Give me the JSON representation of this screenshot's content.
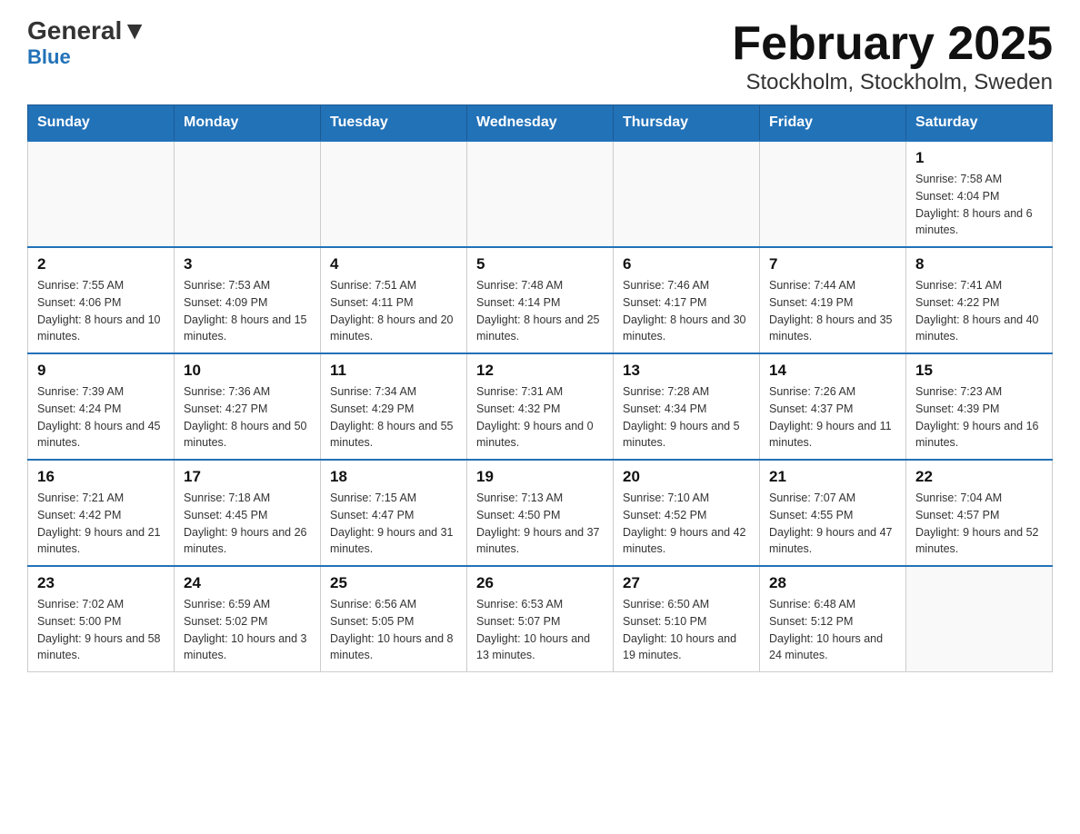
{
  "logo": {
    "line1_part1": "General",
    "line1_part2": "Blue",
    "line2": "Blue"
  },
  "title": "February 2025",
  "subtitle": "Stockholm, Stockholm, Sweden",
  "days_of_week": [
    "Sunday",
    "Monday",
    "Tuesday",
    "Wednesday",
    "Thursday",
    "Friday",
    "Saturday"
  ],
  "weeks": [
    [
      {
        "day": "",
        "sunrise": "",
        "sunset": "",
        "daylight": "",
        "empty": true
      },
      {
        "day": "",
        "sunrise": "",
        "sunset": "",
        "daylight": "",
        "empty": true
      },
      {
        "day": "",
        "sunrise": "",
        "sunset": "",
        "daylight": "",
        "empty": true
      },
      {
        "day": "",
        "sunrise": "",
        "sunset": "",
        "daylight": "",
        "empty": true
      },
      {
        "day": "",
        "sunrise": "",
        "sunset": "",
        "daylight": "",
        "empty": true
      },
      {
        "day": "",
        "sunrise": "",
        "sunset": "",
        "daylight": "",
        "empty": true
      },
      {
        "day": "1",
        "sunrise": "Sunrise: 7:58 AM",
        "sunset": "Sunset: 4:04 PM",
        "daylight": "Daylight: 8 hours and 6 minutes."
      }
    ],
    [
      {
        "day": "2",
        "sunrise": "Sunrise: 7:55 AM",
        "sunset": "Sunset: 4:06 PM",
        "daylight": "Daylight: 8 hours and 10 minutes."
      },
      {
        "day": "3",
        "sunrise": "Sunrise: 7:53 AM",
        "sunset": "Sunset: 4:09 PM",
        "daylight": "Daylight: 8 hours and 15 minutes."
      },
      {
        "day": "4",
        "sunrise": "Sunrise: 7:51 AM",
        "sunset": "Sunset: 4:11 PM",
        "daylight": "Daylight: 8 hours and 20 minutes."
      },
      {
        "day": "5",
        "sunrise": "Sunrise: 7:48 AM",
        "sunset": "Sunset: 4:14 PM",
        "daylight": "Daylight: 8 hours and 25 minutes."
      },
      {
        "day": "6",
        "sunrise": "Sunrise: 7:46 AM",
        "sunset": "Sunset: 4:17 PM",
        "daylight": "Daylight: 8 hours and 30 minutes."
      },
      {
        "day": "7",
        "sunrise": "Sunrise: 7:44 AM",
        "sunset": "Sunset: 4:19 PM",
        "daylight": "Daylight: 8 hours and 35 minutes."
      },
      {
        "day": "8",
        "sunrise": "Sunrise: 7:41 AM",
        "sunset": "Sunset: 4:22 PM",
        "daylight": "Daylight: 8 hours and 40 minutes."
      }
    ],
    [
      {
        "day": "9",
        "sunrise": "Sunrise: 7:39 AM",
        "sunset": "Sunset: 4:24 PM",
        "daylight": "Daylight: 8 hours and 45 minutes."
      },
      {
        "day": "10",
        "sunrise": "Sunrise: 7:36 AM",
        "sunset": "Sunset: 4:27 PM",
        "daylight": "Daylight: 8 hours and 50 minutes."
      },
      {
        "day": "11",
        "sunrise": "Sunrise: 7:34 AM",
        "sunset": "Sunset: 4:29 PM",
        "daylight": "Daylight: 8 hours and 55 minutes."
      },
      {
        "day": "12",
        "sunrise": "Sunrise: 7:31 AM",
        "sunset": "Sunset: 4:32 PM",
        "daylight": "Daylight: 9 hours and 0 minutes."
      },
      {
        "day": "13",
        "sunrise": "Sunrise: 7:28 AM",
        "sunset": "Sunset: 4:34 PM",
        "daylight": "Daylight: 9 hours and 5 minutes."
      },
      {
        "day": "14",
        "sunrise": "Sunrise: 7:26 AM",
        "sunset": "Sunset: 4:37 PM",
        "daylight": "Daylight: 9 hours and 11 minutes."
      },
      {
        "day": "15",
        "sunrise": "Sunrise: 7:23 AM",
        "sunset": "Sunset: 4:39 PM",
        "daylight": "Daylight: 9 hours and 16 minutes."
      }
    ],
    [
      {
        "day": "16",
        "sunrise": "Sunrise: 7:21 AM",
        "sunset": "Sunset: 4:42 PM",
        "daylight": "Daylight: 9 hours and 21 minutes."
      },
      {
        "day": "17",
        "sunrise": "Sunrise: 7:18 AM",
        "sunset": "Sunset: 4:45 PM",
        "daylight": "Daylight: 9 hours and 26 minutes."
      },
      {
        "day": "18",
        "sunrise": "Sunrise: 7:15 AM",
        "sunset": "Sunset: 4:47 PM",
        "daylight": "Daylight: 9 hours and 31 minutes."
      },
      {
        "day": "19",
        "sunrise": "Sunrise: 7:13 AM",
        "sunset": "Sunset: 4:50 PM",
        "daylight": "Daylight: 9 hours and 37 minutes."
      },
      {
        "day": "20",
        "sunrise": "Sunrise: 7:10 AM",
        "sunset": "Sunset: 4:52 PM",
        "daylight": "Daylight: 9 hours and 42 minutes."
      },
      {
        "day": "21",
        "sunrise": "Sunrise: 7:07 AM",
        "sunset": "Sunset: 4:55 PM",
        "daylight": "Daylight: 9 hours and 47 minutes."
      },
      {
        "day": "22",
        "sunrise": "Sunrise: 7:04 AM",
        "sunset": "Sunset: 4:57 PM",
        "daylight": "Daylight: 9 hours and 52 minutes."
      }
    ],
    [
      {
        "day": "23",
        "sunrise": "Sunrise: 7:02 AM",
        "sunset": "Sunset: 5:00 PM",
        "daylight": "Daylight: 9 hours and 58 minutes."
      },
      {
        "day": "24",
        "sunrise": "Sunrise: 6:59 AM",
        "sunset": "Sunset: 5:02 PM",
        "daylight": "Daylight: 10 hours and 3 minutes."
      },
      {
        "day": "25",
        "sunrise": "Sunrise: 6:56 AM",
        "sunset": "Sunset: 5:05 PM",
        "daylight": "Daylight: 10 hours and 8 minutes."
      },
      {
        "day": "26",
        "sunrise": "Sunrise: 6:53 AM",
        "sunset": "Sunset: 5:07 PM",
        "daylight": "Daylight: 10 hours and 13 minutes."
      },
      {
        "day": "27",
        "sunrise": "Sunrise: 6:50 AM",
        "sunset": "Sunset: 5:10 PM",
        "daylight": "Daylight: 10 hours and 19 minutes."
      },
      {
        "day": "28",
        "sunrise": "Sunrise: 6:48 AM",
        "sunset": "Sunset: 5:12 PM",
        "daylight": "Daylight: 10 hours and 24 minutes."
      },
      {
        "day": "",
        "sunrise": "",
        "sunset": "",
        "daylight": "",
        "empty": true
      }
    ]
  ]
}
